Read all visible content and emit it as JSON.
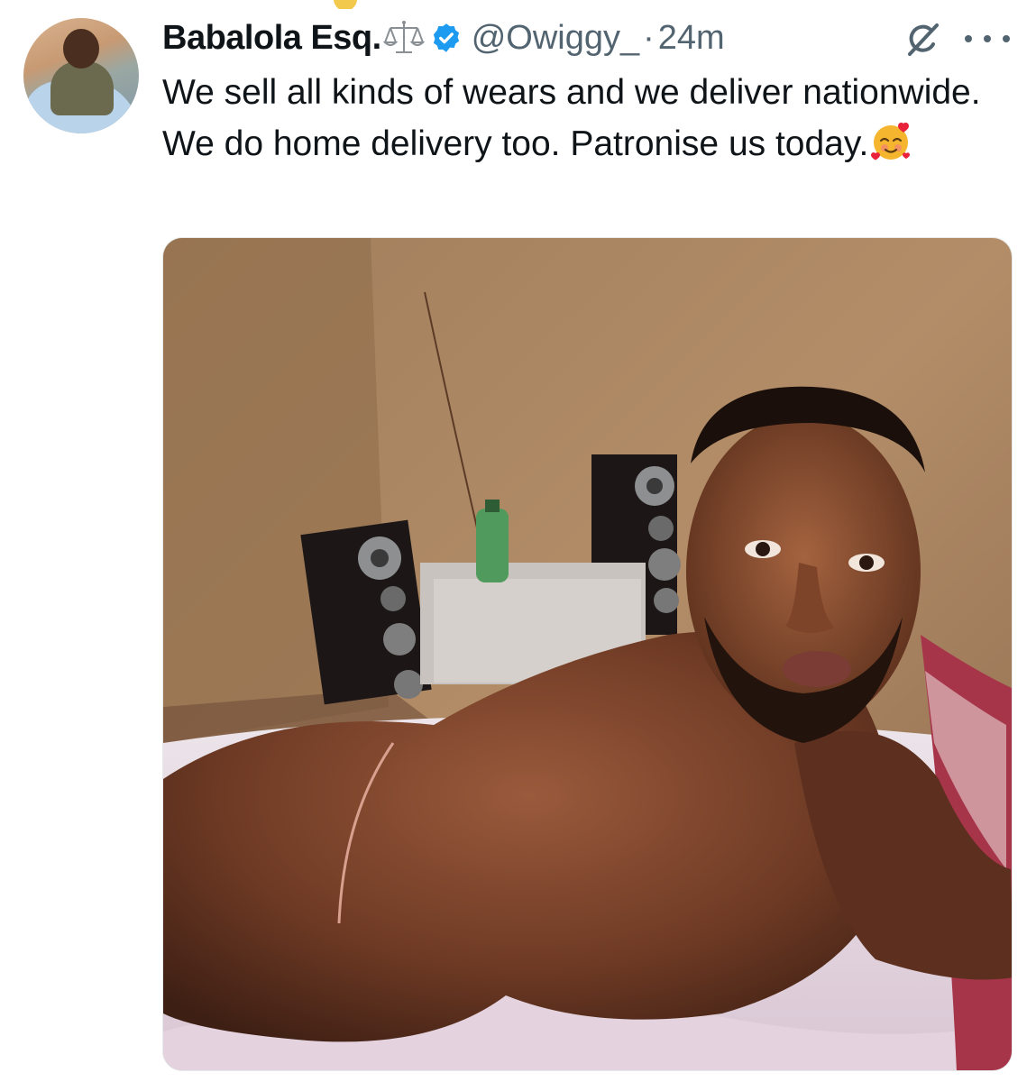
{
  "author": {
    "name": "Babalola Esq.",
    "handle": "@Owiggy_",
    "separator": "·",
    "time": "24m",
    "verified": true,
    "name_icon": "scales-icon"
  },
  "tweet": {
    "text": "We sell all kinds of wears and we deliver nationwide. We do home delivery too. Patronise us today.",
    "emoji": "smiling-face-with-hearts-emoji"
  },
  "icons": {
    "grok": "grok-icon",
    "more": "more-options-icon",
    "verified": "verified-badge-icon"
  },
  "colors": {
    "text_primary": "#0f1419",
    "text_secondary": "#536471",
    "verified_blue": "#1d9bf0"
  }
}
